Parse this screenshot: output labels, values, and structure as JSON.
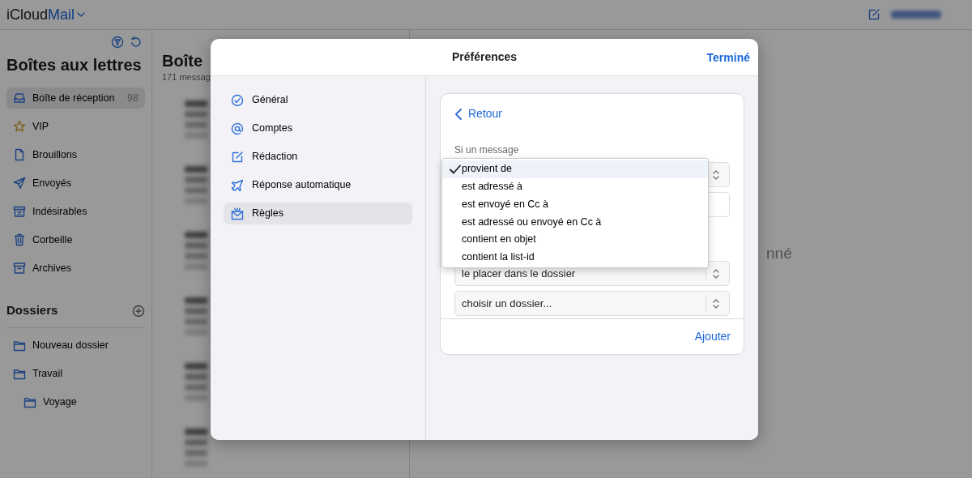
{
  "app": {
    "brand": "iCloud",
    "product": "Mail"
  },
  "sidebar": {
    "title": "Boîtes aux lettres",
    "mailboxes": [
      {
        "label": "Boîte de réception",
        "count": "98",
        "selected": true
      },
      {
        "label": "VIP",
        "selected": false
      },
      {
        "label": "Brouillons",
        "selected": false
      },
      {
        "label": "Envoyés",
        "selected": false
      },
      {
        "label": "Indésirables",
        "selected": false
      },
      {
        "label": "Corbeille",
        "selected": false
      },
      {
        "label": "Archives",
        "selected": false
      }
    ],
    "folders_title": "Dossiers",
    "folders": [
      {
        "label": "Nouveau dossier"
      },
      {
        "label": "Travail",
        "children": [
          {
            "label": "Voyage"
          }
        ]
      }
    ]
  },
  "message_list": {
    "title": "Boîte",
    "count": "171 messag"
  },
  "reading_pane": {
    "text": "nné"
  },
  "preferences": {
    "title": "Préférences",
    "done": "Terminé",
    "nav": [
      {
        "label": "Général",
        "selected": false
      },
      {
        "label": "Comptes",
        "selected": false
      },
      {
        "label": "Rédaction",
        "selected": false
      },
      {
        "label": "Réponse automatique",
        "selected": false
      },
      {
        "label": "Règles",
        "selected": true
      }
    ],
    "rule": {
      "back": "Retour",
      "label": "Si un message",
      "fields": [
        {
          "kind": "select"
        },
        {
          "kind": "input"
        },
        {
          "kind": "select",
          "value": "le placer dans le dossier"
        },
        {
          "kind": "select",
          "value": "choisir un dossier..."
        }
      ],
      "add": "Ajouter",
      "dropdown": [
        {
          "label": "provient de",
          "selected": true
        },
        {
          "label": "est adressé à",
          "selected": false
        },
        {
          "label": "est envoyé en Cc à",
          "selected": false
        },
        {
          "label": "est adressé ou envoyé en Cc à",
          "selected": false
        },
        {
          "label": "contient en objet",
          "selected": false
        },
        {
          "label": "contient la list-id",
          "selected": false
        }
      ]
    }
  }
}
